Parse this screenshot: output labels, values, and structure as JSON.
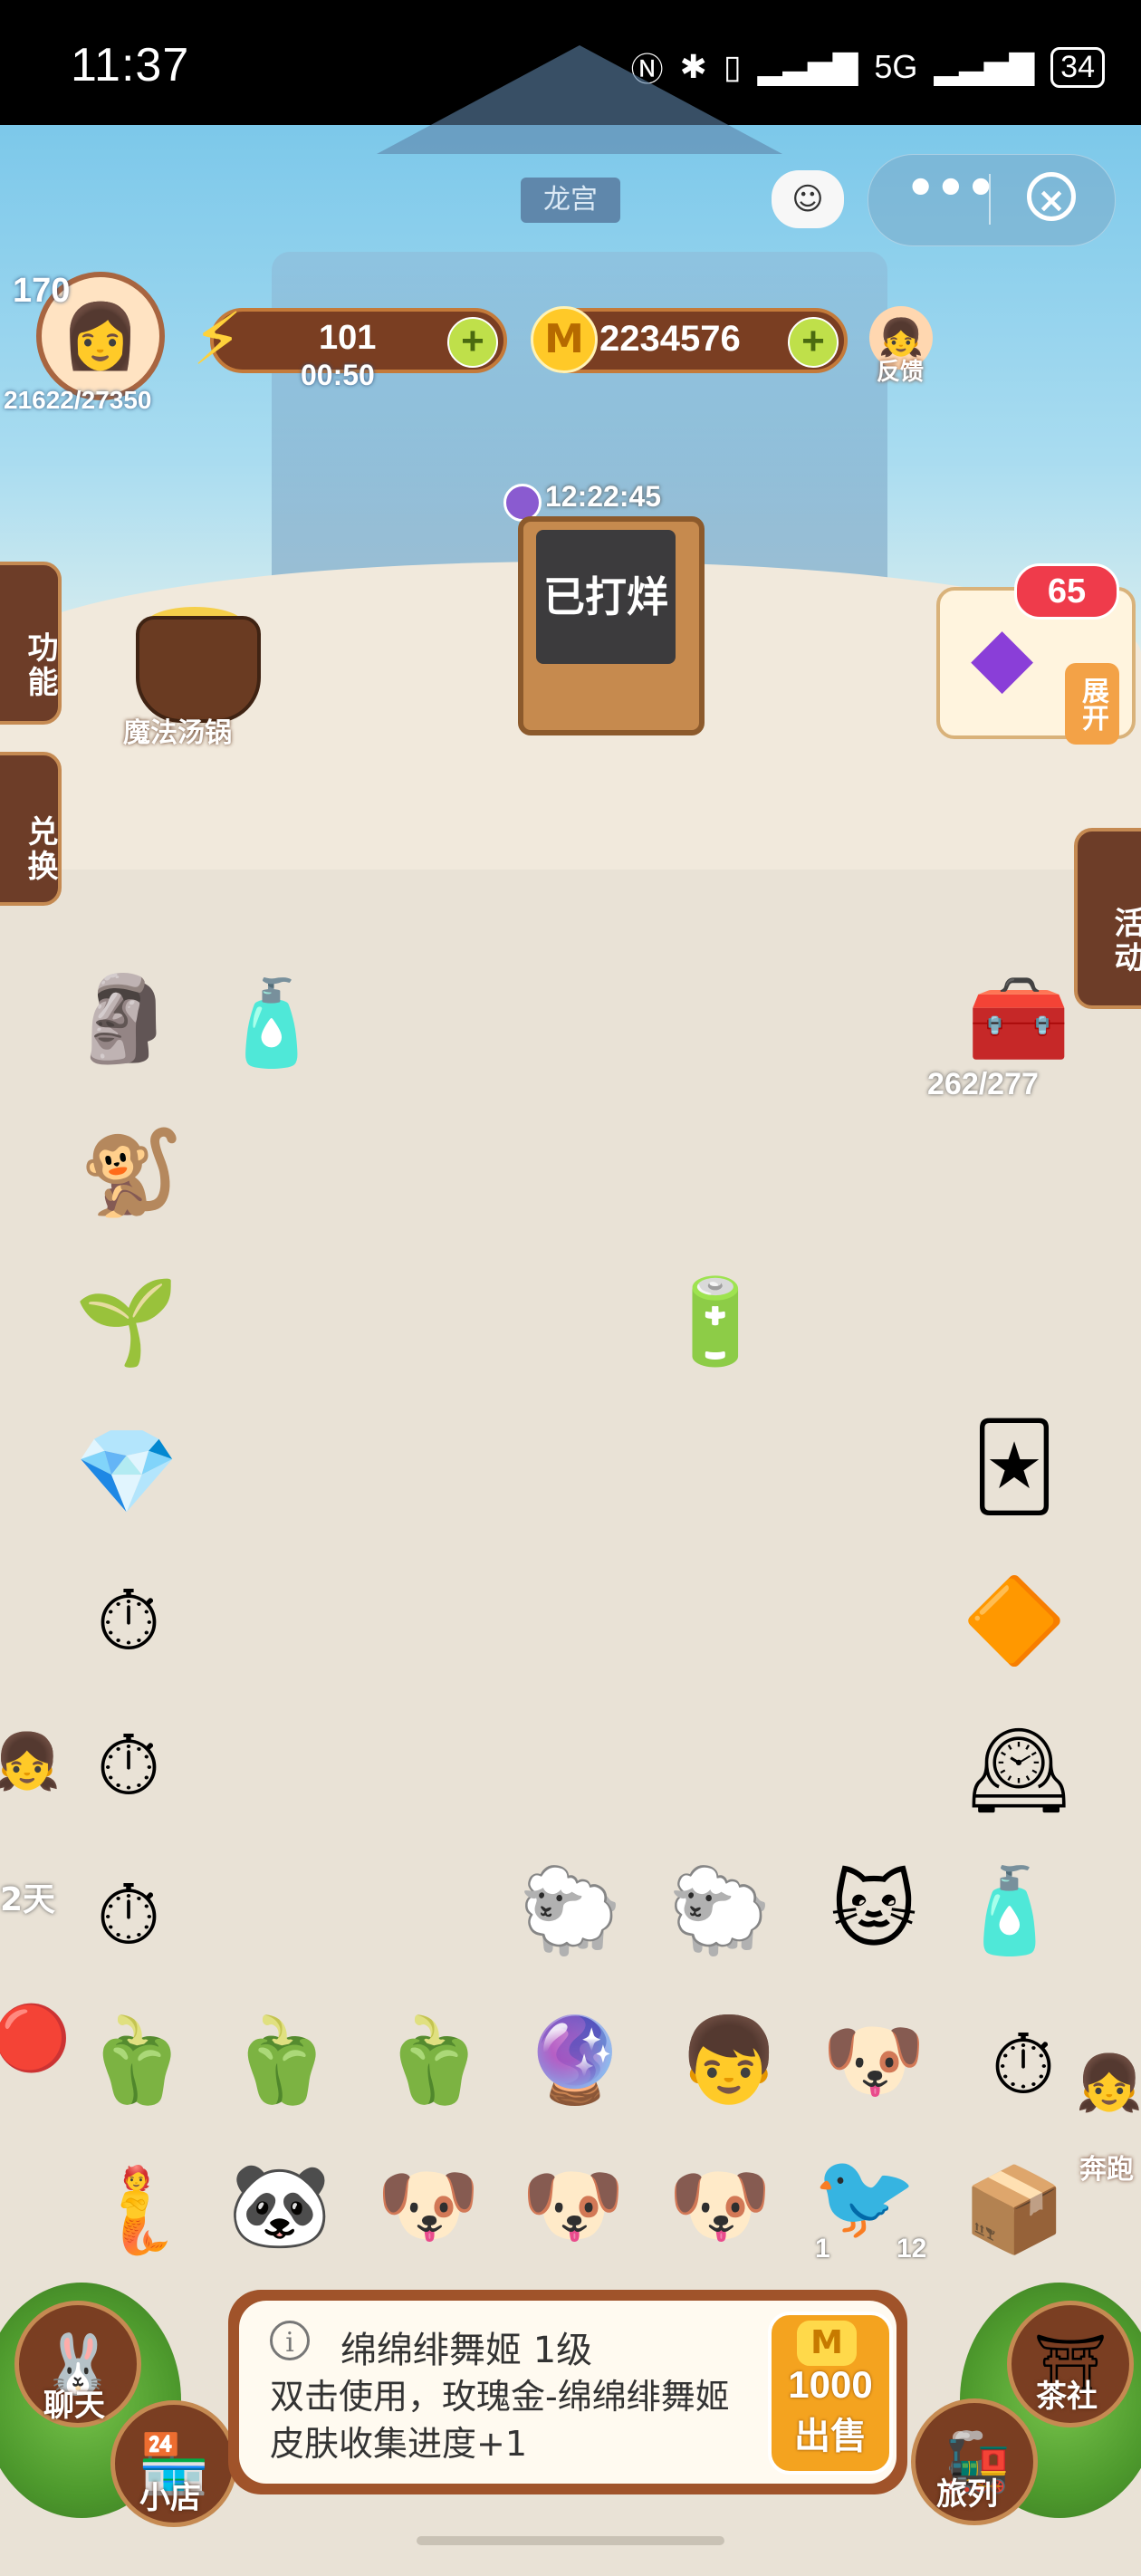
{
  "status_bar": {
    "time": "11:37",
    "network": "5G",
    "battery": "34"
  },
  "player": {
    "level": "170",
    "xp": "21622/27350"
  },
  "resources": {
    "energy": "101",
    "energy_timer": "00:50",
    "coins": "2234576"
  },
  "feedback": {
    "label": "反馈"
  },
  "scene": {
    "palace_sign": "龙宫",
    "shop_timer": "12:22:45",
    "shop_board": "已打烊"
  },
  "left_menu": {
    "function": "功能",
    "exchange": "兑换",
    "soup_pot": "魔法汤锅"
  },
  "right_menu": {
    "crystal_count": "65",
    "expand": "展开",
    "events": "活动"
  },
  "board": {
    "chest_count": "262/277",
    "timer_days": "2天",
    "counter_a": "1",
    "counter_b": "12"
  },
  "side_run": {
    "label": "奔跑"
  },
  "item_info": {
    "title": "绵绵绯舞姬 1级",
    "description": "双击使用，玫瑰金-绵绵绯舞姬皮肤收集进度+1",
    "sell_price": "1000",
    "sell_label": "出售"
  },
  "bottom_nav": {
    "chat": "聊天",
    "shop": "小店",
    "tea": "茶社",
    "travel": "旅列"
  },
  "colors": {
    "wood": "#7a3e22",
    "wood_border": "#c58a52",
    "sand": "#f1e9dc",
    "badge_red": "#ef3b4b",
    "gold": "#f4a31f"
  }
}
